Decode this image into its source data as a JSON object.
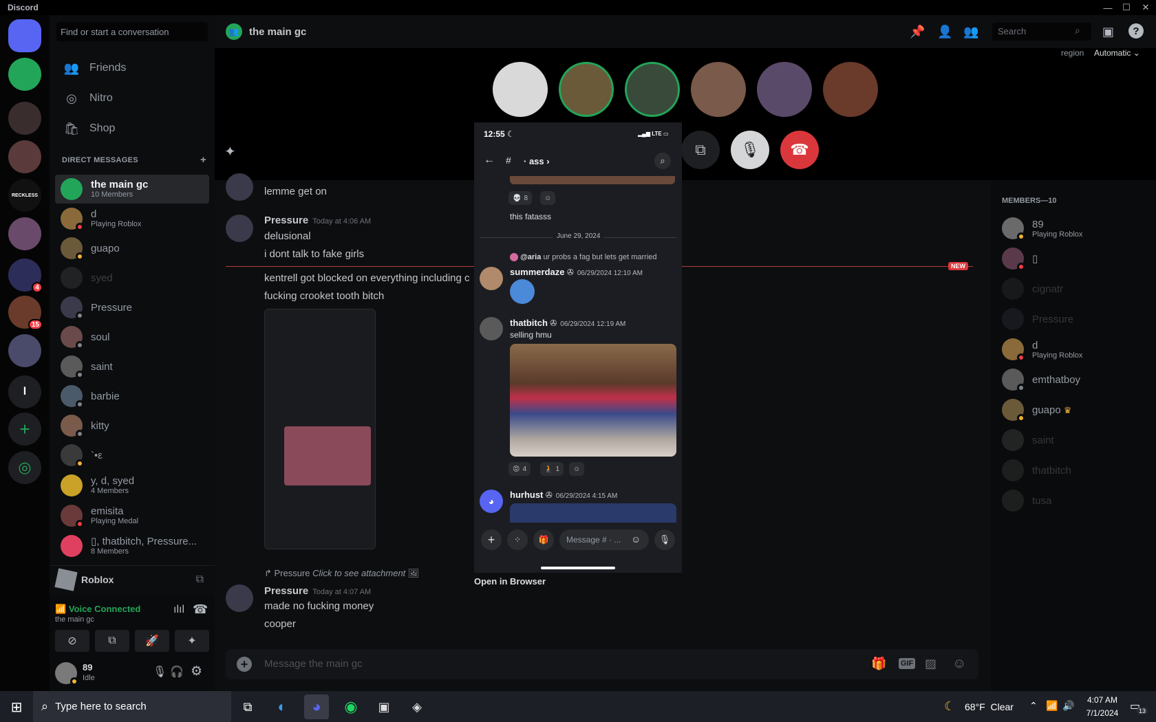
{
  "window": {
    "title": "Discord",
    "minimize": "—",
    "maximize": "☐",
    "close": "✕"
  },
  "guilds": [
    {
      "name": "home",
      "color": "#5865f2"
    },
    {
      "name": "call",
      "color": "#23a559"
    },
    {
      "name": "server-3",
      "color": "#3a2d2d"
    },
    {
      "name": "server-4",
      "color": "#5a3a3a"
    },
    {
      "name": "reckless",
      "color": "#111111",
      "label": "RECKLESS"
    },
    {
      "name": "server-6",
      "color": "#6a4a6a"
    },
    {
      "name": "yumaidos",
      "color": "#2d2d5a",
      "badge": "4"
    },
    {
      "name": "server-8",
      "color": "#6a3a2a",
      "badge": "15"
    },
    {
      "name": "server-9",
      "color": "#4a4a6a"
    },
    {
      "name": "l",
      "color": "#1e1f22",
      "label": "l"
    }
  ],
  "dm_panel": {
    "search_placeholder": "Find or start a conversation",
    "nav": [
      {
        "label": "Friends",
        "icon": "👥"
      },
      {
        "label": "Nitro",
        "icon": "◎"
      },
      {
        "label": "Shop",
        "icon": "🛍"
      }
    ],
    "header": "DIRECT MESSAGES",
    "add": "+",
    "dms": [
      {
        "name": "the main gc",
        "sub": "10 Members",
        "color": "#23a559",
        "active": true
      },
      {
        "name": "d",
        "sub": "Playing Roblox",
        "color": "#8a6a3a",
        "status": "#f23f43"
      },
      {
        "name": "guapo",
        "sub": "",
        "color": "#6a5a3a",
        "status": "#f0b232"
      },
      {
        "name": "syed",
        "sub": "",
        "color": "#4a4a4a",
        "dim": true
      },
      {
        "name": "Pressure",
        "sub": "",
        "color": "#3a3a4a",
        "status": "#80848e"
      },
      {
        "name": "soul",
        "sub": "",
        "color": "#6a4a4a",
        "status": "#80848e"
      },
      {
        "name": "saint",
        "sub": "",
        "color": "#5a5a5a",
        "status": "#80848e"
      },
      {
        "name": "barbie",
        "sub": "",
        "color": "#4a5a6a",
        "status": "#80848e"
      },
      {
        "name": "kitty",
        "sub": "",
        "color": "#7a5a4a",
        "status": "#80848e"
      },
      {
        "name": "`•ε",
        "sub": "",
        "color": "#3a3a3a",
        "status": "#f0b232"
      },
      {
        "name": "y, d, syed",
        "sub": "4 Members",
        "color": "#c9a227"
      },
      {
        "name": "emisita",
        "sub": "Playing Medal",
        "color": "#6a3a3a",
        "status": "#f23f43"
      },
      {
        "name": "▯, thatbitch, Pressure...",
        "sub": "8 Members",
        "color": "#e04060"
      }
    ],
    "activity": {
      "name": "Roblox"
    }
  },
  "voice": {
    "status": "Voice Connected",
    "channel": "the main gc"
  },
  "user": {
    "name": "89",
    "status": "Idle"
  },
  "channel": {
    "name": "the main gc",
    "search": "Search",
    "region_label": "region",
    "region_value": "Automatic"
  },
  "chat": {
    "m1": "lemme get on",
    "m2_author": "Pressure",
    "m2_time": "Today at 4:06 AM",
    "m2_l1": "delusional",
    "m2_l2": "i dont talk to fake girls",
    "m3_l1": "kentrell got blocked on everything including c",
    "m3_l2": "fucking crooket tooth bitch",
    "new_badge": "NEW",
    "reply_author": "Pressure",
    "reply_text": "Click to see attachment",
    "m4_author": "Pressure",
    "m4_time": "Today at 4:07 AM",
    "m4_l1": "made no fucking money",
    "m4_l2": "cooper",
    "input_placeholder": "Message the main gc"
  },
  "members": {
    "header": "MEMBERS—10",
    "list": [
      {
        "name": "89",
        "sub": "Playing Roblox",
        "color": "#6a6a6a",
        "status": "#f0b232"
      },
      {
        "name": "▯",
        "sub": "",
        "color": "#5a3a4a",
        "status": "#f23f43"
      },
      {
        "name": "cignatr",
        "sub": "",
        "color": "#3a3a3a",
        "dim": true
      },
      {
        "name": "Pressure",
        "sub": "",
        "color": "#3a3a4a",
        "dim": true
      },
      {
        "name": "d",
        "sub": "Playing Roblox",
        "color": "#8a6a3a",
        "status": "#f23f43"
      },
      {
        "name": "emthatboy",
        "sub": "",
        "color": "#5a5a5a",
        "status": "#80848e"
      },
      {
        "name": "guapo",
        "sub": "",
        "color": "#6a5a3a",
        "status": "#f0b232",
        "crown": "♛"
      },
      {
        "name": "saint",
        "sub": "",
        "color": "#5a5a5a",
        "dim": true
      },
      {
        "name": "thatbitch",
        "sub": "",
        "color": "#4a4a4a",
        "dim": true
      },
      {
        "name": "tusa",
        "sub": "",
        "color": "#4a4a4a",
        "dim": true
      }
    ]
  },
  "phone": {
    "clock": "12:55",
    "signal": "LTE",
    "channel": "ass",
    "react1_count": "8",
    "msg_top": "this fatasss",
    "date_divider": "June 29, 2024",
    "reply_mention": "@aria",
    "reply_text": "ur probs a fag but lets get married",
    "a1_name": "summerdaze",
    "a1_time": "06/29/2024 12:10 AM",
    "a2_name": "thatbitch",
    "a2_time": "06/29/2024 12:19 AM",
    "a2_text": "selling hmu",
    "react2_count": "4",
    "react3_count": "1",
    "a3_name": "hurhust",
    "a3_time": "06/29/2024 4:15 AM",
    "input_placeholder": "Message # · ...",
    "open_browser": "Open in Browser"
  },
  "taskbar": {
    "search_placeholder": "Type here to search",
    "weather": "68°F  Clear",
    "time": "4:07 AM",
    "date": "7/1/2024",
    "notif_count": "13"
  }
}
